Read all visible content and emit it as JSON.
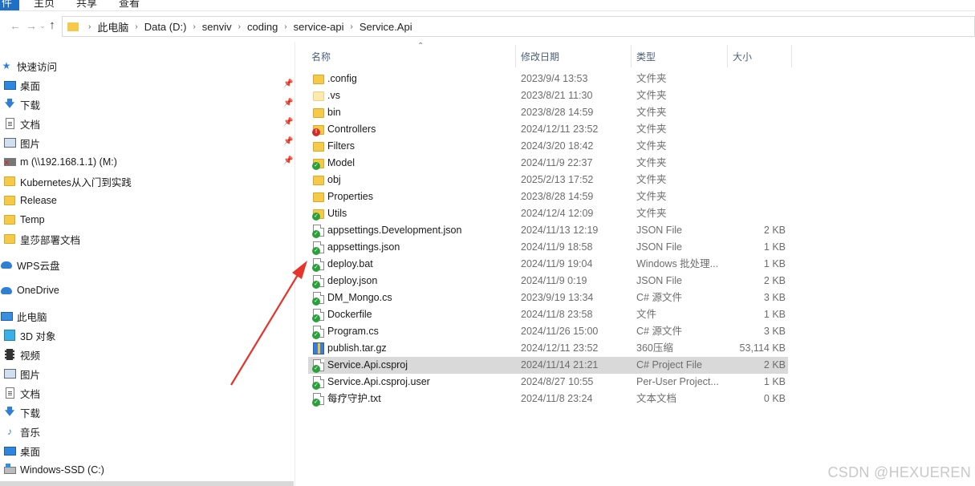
{
  "ribbon": {
    "tabs": [
      "件",
      "主页",
      "共享",
      "查看"
    ]
  },
  "address": {
    "crumbs": [
      "此电脑",
      "Data (D:)",
      "senviv",
      "coding",
      "service-api",
      "Service.Api"
    ]
  },
  "sidebar": {
    "quick_access": "快速访问",
    "items": [
      {
        "label": "桌面",
        "icon": "desktop-icon"
      },
      {
        "label": "下载",
        "icon": "download-icon"
      },
      {
        "label": "文档",
        "icon": "document-icon"
      },
      {
        "label": "图片",
        "icon": "pictures-icon"
      },
      {
        "label": "m (\\\\192.168.1.1) (M:)",
        "icon": "network-drive-icon"
      },
      {
        "label": "Kubernetes从入门到实践",
        "icon": "folder-icon"
      },
      {
        "label": "Release",
        "icon": "folder-icon"
      },
      {
        "label": "Temp",
        "icon": "folder-icon"
      },
      {
        "label": "皇莎部署文档",
        "icon": "folder-icon"
      }
    ],
    "wps": "WPS云盘",
    "onedrive": "OneDrive",
    "thispc": "此电脑",
    "pc_items": [
      {
        "label": "3D 对象",
        "icon": "3d-objects-icon"
      },
      {
        "label": "视频",
        "icon": "video-icon"
      },
      {
        "label": "图片",
        "icon": "pictures-icon"
      },
      {
        "label": "文档",
        "icon": "document-icon"
      },
      {
        "label": "下载",
        "icon": "download-icon"
      },
      {
        "label": "音乐",
        "icon": "music-icon"
      },
      {
        "label": "桌面",
        "icon": "desktop-icon"
      },
      {
        "label": "Windows-SSD (C:)",
        "icon": "drive-icon"
      }
    ]
  },
  "columns": {
    "name": "名称",
    "date": "修改日期",
    "type": "类型",
    "size": "大小"
  },
  "files": [
    {
      "name": ".config",
      "date": "2023/9/4 13:53",
      "type": "文件夹",
      "size": "",
      "icon": "folder"
    },
    {
      "name": ".vs",
      "date": "2023/8/21 11:30",
      "type": "文件夹",
      "size": "",
      "icon": "folder-light"
    },
    {
      "name": "bin",
      "date": "2023/8/28 14:59",
      "type": "文件夹",
      "size": "",
      "icon": "folder"
    },
    {
      "name": "Controllers",
      "date": "2024/12/11 23:52",
      "type": "文件夹",
      "size": "",
      "icon": "folder-err"
    },
    {
      "name": "Filters",
      "date": "2024/3/20 18:42",
      "type": "文件夹",
      "size": "",
      "icon": "folder"
    },
    {
      "name": "Model",
      "date": "2024/11/9 22:37",
      "type": "文件夹",
      "size": "",
      "icon": "folder-ok"
    },
    {
      "name": "obj",
      "date": "2025/2/13 17:52",
      "type": "文件夹",
      "size": "",
      "icon": "folder"
    },
    {
      "name": "Properties",
      "date": "2023/8/28 14:59",
      "type": "文件夹",
      "size": "",
      "icon": "folder"
    },
    {
      "name": "Utils",
      "date": "2024/12/4 12:09",
      "type": "文件夹",
      "size": "",
      "icon": "folder-ok"
    },
    {
      "name": "appsettings.Development.json",
      "date": "2024/11/13 12:19",
      "type": "JSON File",
      "size": "2 KB",
      "icon": "file-ok"
    },
    {
      "name": "appsettings.json",
      "date": "2024/11/9 18:58",
      "type": "JSON File",
      "size": "1 KB",
      "icon": "file-ok"
    },
    {
      "name": "deploy.bat",
      "date": "2024/11/9 19:04",
      "type": "Windows 批处理...",
      "size": "1 KB",
      "icon": "file-ok"
    },
    {
      "name": "deploy.json",
      "date": "2024/11/9 0:19",
      "type": "JSON File",
      "size": "2 KB",
      "icon": "file-ok"
    },
    {
      "name": "DM_Mongo.cs",
      "date": "2023/9/19 13:34",
      "type": "C# 源文件",
      "size": "3 KB",
      "icon": "file-ok"
    },
    {
      "name": "Dockerfile",
      "date": "2024/11/8 23:58",
      "type": "文件",
      "size": "1 KB",
      "icon": "file-ok"
    },
    {
      "name": "Program.cs",
      "date": "2024/11/26 15:00",
      "type": "C# 源文件",
      "size": "3 KB",
      "icon": "file-ok"
    },
    {
      "name": "publish.tar.gz",
      "date": "2024/12/11 23:52",
      "type": "360压缩",
      "size": "53,114 KB",
      "icon": "archive"
    },
    {
      "name": "Service.Api.csproj",
      "date": "2024/11/14 21:21",
      "type": "C# Project File",
      "size": "2 KB",
      "icon": "file-ok",
      "selected": true
    },
    {
      "name": "Service.Api.csproj.user",
      "date": "2024/8/27 10:55",
      "type": "Per-User Project...",
      "size": "1 KB",
      "icon": "file-ok"
    },
    {
      "name": "每疗守护.txt",
      "date": "2024/11/8 23:24",
      "type": "文本文档",
      "size": "0 KB",
      "icon": "file-ok"
    }
  ],
  "watermark": "CSDN @HEXUEREN",
  "colors": {
    "accent": "#1f6fc5",
    "folder": "#f5c94a",
    "selected_row": "#d9d9d9",
    "annotation_arrow": "#e8332a"
  }
}
